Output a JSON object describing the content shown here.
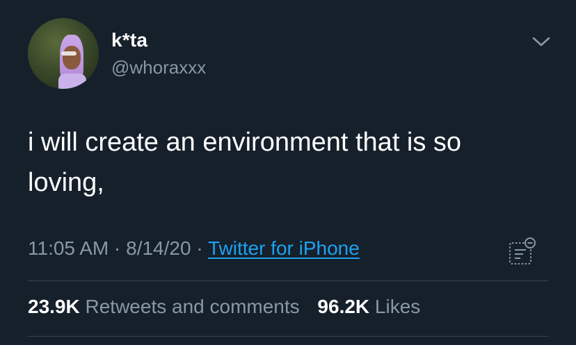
{
  "tweet": {
    "display_name": "k*ta",
    "handle": "@whoraxxx",
    "text": "i will create an environment that is so loving,",
    "time": "11:05 AM",
    "date": "8/14/20",
    "separator": "·",
    "source": "Twitter for iPhone"
  },
  "stats": {
    "retweets_count": "23.9K",
    "retweets_label": "Retweets and comments",
    "likes_count": "96.2K",
    "likes_label": "Likes"
  },
  "icons": {
    "more": "chevron-down-icon",
    "analytics": "analytics-icon"
  },
  "colors": {
    "background": "#15202b",
    "text_primary": "#ffffff",
    "text_secondary": "#8899a6",
    "link": "#1da1f2",
    "divider": "#38444d"
  }
}
